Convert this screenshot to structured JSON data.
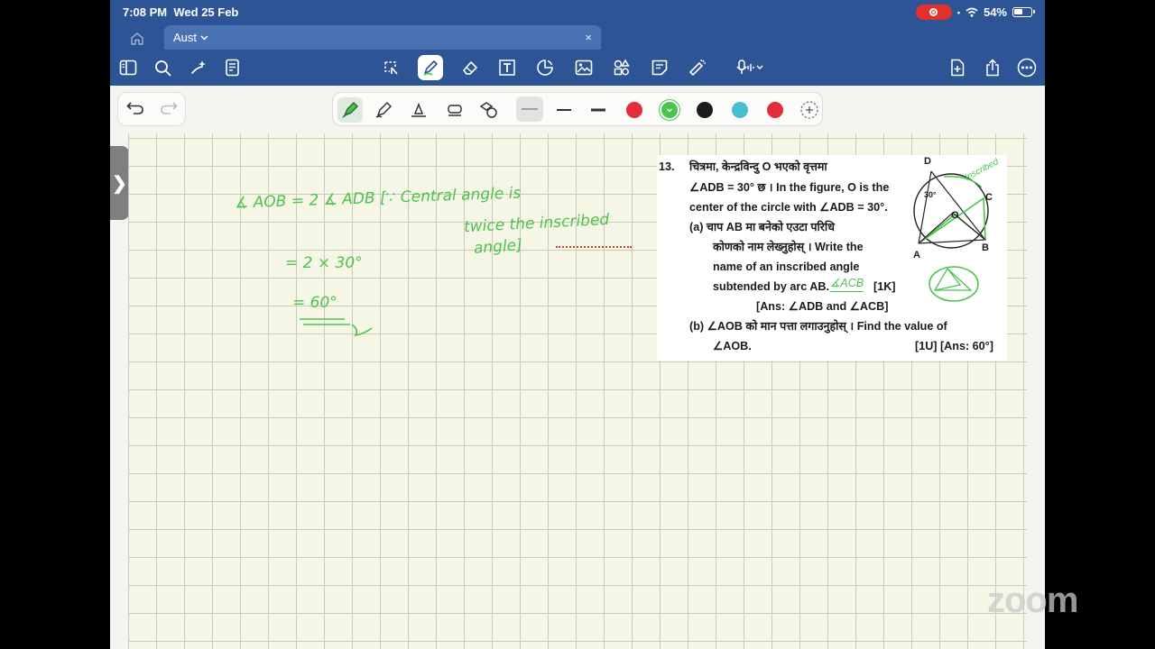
{
  "status": {
    "time": "7:08 PM",
    "date": "Wed 25 Feb",
    "battery": "54%"
  },
  "tab": {
    "name": "Aust",
    "close": "×"
  },
  "toolbar": {
    "colors": [
      "#e42d3a",
      "#4bc44b",
      "#1c1c1c",
      "#45c0d0",
      "#e42d3a"
    ],
    "selected_color": 1
  },
  "side_tab": {
    "label": "❯"
  },
  "notes": {
    "line1": "∡ AOB = 2 ∡ ADB [∵ Central angle is",
    "line2": "twice the inscribed",
    "line3": "angle]",
    "line4": "= 2 × 30°",
    "line5": "= 60°"
  },
  "question": {
    "number": "13.",
    "np1": "चित्रमा, केन्द्रविन्दु O भएको वृत्तमा",
    "l1": "∠ADB = 30° छ । In the figure, O is the",
    "l2": "center of the circle with ∠ADB = 30°.",
    "a_np": "(a) चाप AB मा बनेको एउटा परिधि",
    "a_np2": "कोणको नाम लेख्नुहोस् । Write the",
    "a_l3": "name of an inscribed angle",
    "a_l4": "subtended by arc AB.",
    "a_hand": "∡ACB",
    "a_mark": "[1K]",
    "a_ans": "[Ans: ∠ADB and ∠ACB]",
    "b_np": "(b) ∠AOB को मान पत्ता लगाउनुहोस् । Find the value of",
    "b_l2": "∠AOB.",
    "b_mark": "[1U] [Ans: 60°]",
    "fig": {
      "D": "D",
      "C": "C",
      "O": "O",
      "A": "A",
      "B": "B",
      "angle": "30°",
      "note": "Inscribed"
    }
  },
  "zoom": "zoom"
}
